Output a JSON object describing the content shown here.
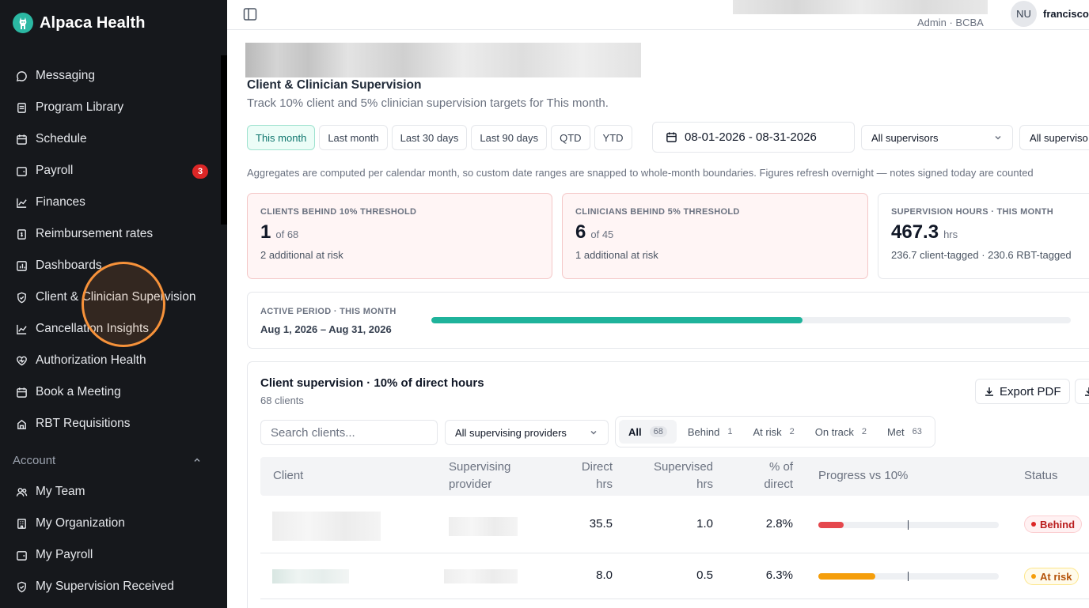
{
  "app": {
    "name": "Alpaca Health"
  },
  "sidebar": {
    "items": [
      {
        "label": "Messaging",
        "icon": "message-icon"
      },
      {
        "label": "Program Library",
        "icon": "library-icon"
      },
      {
        "label": "Schedule",
        "icon": "calendar-icon"
      },
      {
        "label": "Payroll",
        "icon": "wallet-icon",
        "badge": "3"
      },
      {
        "label": "Finances",
        "icon": "line-chart-icon"
      },
      {
        "label": "Reimbursement rates",
        "icon": "receipt-icon"
      },
      {
        "label": "Dashboards",
        "icon": "dashboard-icon"
      },
      {
        "label": "Client & Clinician Supervision",
        "icon": "shield-check-icon"
      },
      {
        "label": "Cancellation Insights",
        "icon": "line-chart-icon"
      },
      {
        "label": "Authorization Health",
        "icon": "heart-icon"
      },
      {
        "label": "Book a Meeting",
        "icon": "calendar-icon"
      },
      {
        "label": "RBT Requisitions",
        "icon": "briefcase-icon"
      }
    ],
    "account_section": "Account",
    "account_items": [
      {
        "label": "My Team",
        "icon": "users-icon"
      },
      {
        "label": "My Organization",
        "icon": "building-icon"
      },
      {
        "label": "My Payroll",
        "icon": "wallet-icon"
      },
      {
        "label": "My Supervision Received",
        "icon": "shield-check-icon"
      }
    ]
  },
  "topbar": {
    "role": "Admin · BCBA",
    "avatar_initials": "NU",
    "username": "francisco"
  },
  "page": {
    "title": "Client & Clinician Supervision",
    "subtitle": "Track 10% client and 5% clinician supervision targets for This month."
  },
  "periods": [
    "This month",
    "Last month",
    "Last 30 days",
    "Last 90 days",
    "QTD",
    "YTD"
  ],
  "active_period": "This month",
  "date_range": "08-01-2026 - 08-31-2026",
  "filters": {
    "supervisors": "All supervisors",
    "supervisors2": "All superviso"
  },
  "notice": "Aggregates are computed per calendar month, so custom date ranges are snapped to whole-month boundaries. Figures refresh overnight — notes signed today are counted",
  "cards": [
    {
      "label": "CLIENTS BEHIND 10% THRESHOLD",
      "value": "1",
      "of": "of 68",
      "note": "2 additional at risk"
    },
    {
      "label": "CLINICIANS BEHIND 5% THRESHOLD",
      "value": "6",
      "of": "of 45",
      "note": "1 additional at risk"
    },
    {
      "label": "SUPERVISION HOURS · THIS MONTH",
      "value": "467.3",
      "of": "hrs",
      "note": "236.7 client-tagged · 230.6 RBT-tagged"
    }
  ],
  "active_period_card": {
    "label": "ACTIVE PERIOD · THIS MONTH",
    "dates": "Aug 1, 2026 – Aug 31, 2026",
    "progress": 0.58
  },
  "client_table": {
    "title": "Client supervision · 10% of direct hours",
    "count": "68 clients",
    "export_label": "Export PDF",
    "search_placeholder": "Search clients...",
    "provider_filter": "All supervising providers",
    "segments": [
      {
        "label": "All",
        "count": "68"
      },
      {
        "label": "Behind",
        "count": "1"
      },
      {
        "label": "At risk",
        "count": "2"
      },
      {
        "label": "On track",
        "count": "2"
      },
      {
        "label": "Met",
        "count": "63"
      }
    ],
    "columns": {
      "client": "Client",
      "provider_1": "Supervising",
      "provider_2": "provider",
      "direct_1": "Direct",
      "direct_2": "hrs",
      "supervised_1": "Supervised",
      "supervised_2": "hrs",
      "pct_1": "% of",
      "pct_2": "direct",
      "progress": "Progress vs 10%",
      "status": "Status"
    },
    "rows": [
      {
        "direct": "35.5",
        "supervised": "1.0",
        "pct": "2.8%",
        "progress": 0.28,
        "status": "Behind",
        "status_color": "#e5484d"
      },
      {
        "direct": "8.0",
        "supervised": "0.5",
        "pct": "6.3%",
        "progress": 0.63,
        "status": "At risk",
        "status_color": "#f59e0b"
      }
    ]
  },
  "colors": {
    "accent": "#1fb39b",
    "sidebar": "#16181c",
    "behind": "#e5484d",
    "at_risk": "#f59e0b",
    "highlight": "#f7923a"
  }
}
